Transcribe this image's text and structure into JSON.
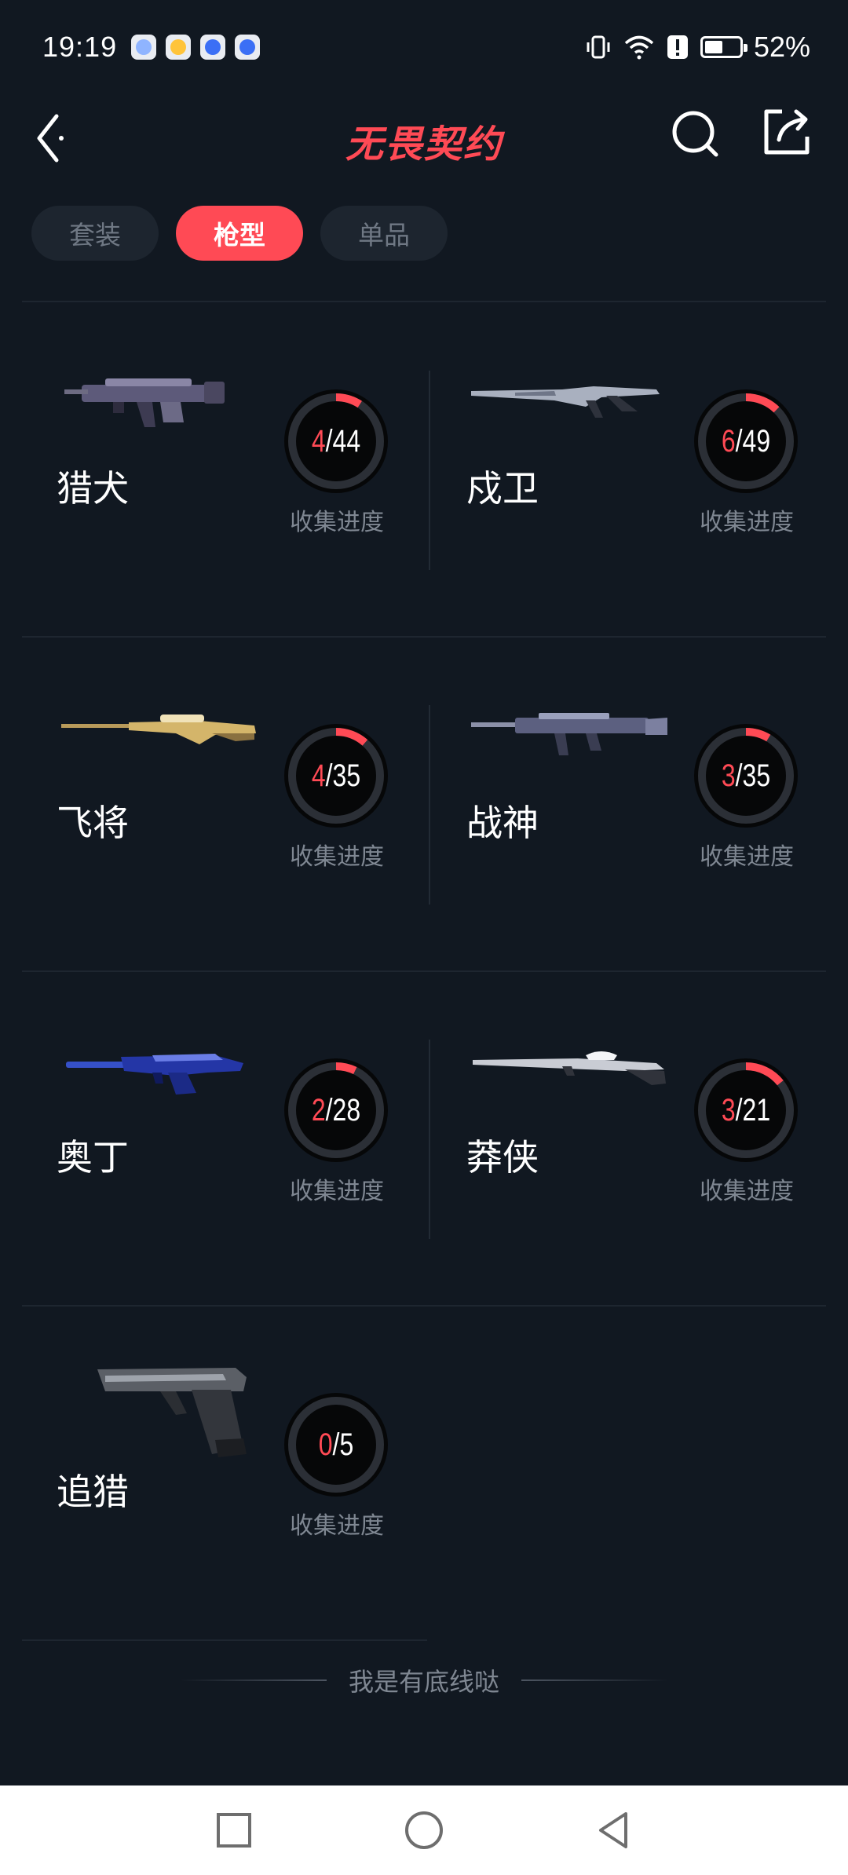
{
  "status": {
    "time": "19:19",
    "battery": "52%",
    "battery_fraction": 0.52
  },
  "header": {
    "title": "无畏契约"
  },
  "tabs": [
    {
      "label": "套装",
      "active": false
    },
    {
      "label": "枪型",
      "active": true
    },
    {
      "label": "单品",
      "active": false
    }
  ],
  "progress_label": "收集进度",
  "weapons": [
    {
      "name": "猎犬",
      "owned": "4",
      "total": "/44",
      "fraction": 0.0909,
      "icon": "smg-icon"
    },
    {
      "name": "戍卫",
      "owned": "6",
      "total": "/49",
      "fraction": 0.1224,
      "icon": "rifle-icon"
    },
    {
      "name": "飞将",
      "owned": "4",
      "total": "/35",
      "fraction": 0.1143,
      "icon": "sniper-icon"
    },
    {
      "name": "战神",
      "owned": "3",
      "total": "/35",
      "fraction": 0.0857,
      "icon": "lmg-icon"
    },
    {
      "name": "奥丁",
      "owned": "2",
      "total": "/28",
      "fraction": 0.0714,
      "icon": "heavy-gun-icon"
    },
    {
      "name": "莽侠",
      "owned": "3",
      "total": "/21",
      "fraction": 0.1429,
      "icon": "marksman-rifle-icon"
    },
    {
      "name": "追猎",
      "owned": "0",
      "total": "/5",
      "fraction": 0.0,
      "icon": "pistol-icon"
    }
  ],
  "footer": {
    "text": "我是有底线哒"
  },
  "colors": {
    "accent": "#ff4a55",
    "background": "#111821",
    "tab_inactive": "#1d252f",
    "ring_track": "#2b2f36"
  }
}
